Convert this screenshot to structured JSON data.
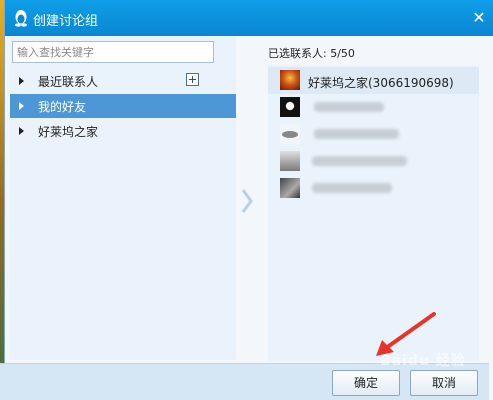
{
  "window": {
    "title": "创建讨论组",
    "close_glyph": "✕"
  },
  "search": {
    "placeholder": "输入查找关键字",
    "value": ""
  },
  "groups": [
    {
      "label": "最近联系人",
      "selected": false
    },
    {
      "label": "我的好友",
      "selected": true
    },
    {
      "label": "好莱坞之家",
      "selected": false
    }
  ],
  "selected_header": "已选联系人: 5/50",
  "contacts": [
    {
      "name": "好莱坞之家(3066190698)",
      "avatar": "group-avatar-icon"
    },
    {
      "name": "",
      "avatar": "contact-avatar-icon"
    },
    {
      "name": "",
      "avatar": "contact-avatar-icon"
    },
    {
      "name": "",
      "avatar": "contact-avatar-icon"
    },
    {
      "name": "",
      "avatar": "contact-avatar-icon"
    }
  ],
  "buttons": {
    "ok": "确定",
    "cancel": "取消"
  },
  "watermark": "Baidu 经验",
  "colors": {
    "titlebar": "#0a92de",
    "selected_row": "#4e97d7",
    "pointer": "#e8332a"
  }
}
